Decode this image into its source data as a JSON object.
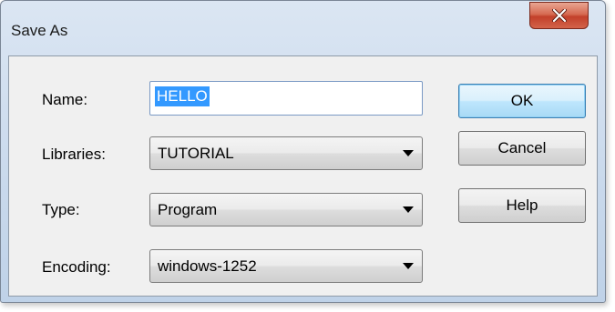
{
  "window": {
    "title": "Save As",
    "close_icon": "close-icon"
  },
  "form": {
    "name": {
      "label": "Name:",
      "value": "HELLO"
    },
    "libraries": {
      "label": "Libraries:",
      "value": "TUTORIAL"
    },
    "type": {
      "label": "Type:",
      "value": "Program"
    },
    "encoding": {
      "label": "Encoding:",
      "value": "windows-1252"
    }
  },
  "buttons": {
    "ok": "OK",
    "cancel": "Cancel",
    "help": "Help"
  },
  "colors": {
    "selection": "#3399ff",
    "close_button": "#c2402a",
    "default_button_border": "#3c7fb1"
  }
}
